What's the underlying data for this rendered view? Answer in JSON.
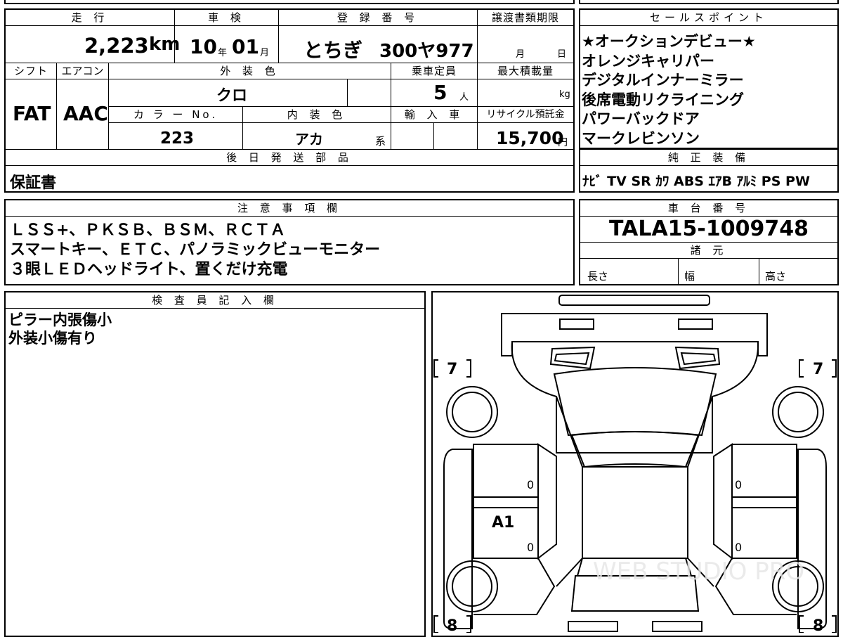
{
  "top_info": {
    "mileage_label": "走 行",
    "mileage_value": "2,223",
    "mileage_unit": "km",
    "inspection_label": "車 検",
    "inspection_year": "10",
    "inspection_year_unit": "年",
    "inspection_month": "01",
    "inspection_month_unit": "月",
    "registration_label": "登 録 番 号",
    "registration_region": "とちぎ",
    "registration_number": "300ヤ977",
    "transfer_deadline_label": "譲渡書類期限",
    "transfer_month_unit": "月",
    "transfer_day_unit": "日"
  },
  "spec": {
    "shift_label": "シフト",
    "shift_value": "FAT",
    "aircon_label": "エアコン",
    "aircon_value": "AAC",
    "exterior_color_label": "外 装 色",
    "exterior_color_value": "クロ",
    "capacity_label": "乗車定員",
    "capacity_value": "5",
    "capacity_unit": "人",
    "max_load_label": "最大積載量",
    "max_load_unit": "kg",
    "color_no_label": "カ ラ ー No.",
    "color_no_value": "223",
    "interior_color_label": "内 装 色",
    "interior_color_value": "アカ",
    "interior_color_suffix": "系",
    "import_label": "輸 入 車",
    "recycle_label": "リサイクル預託金",
    "recycle_value": "15,700",
    "recycle_unit": "円"
  },
  "later_parts": {
    "label": "後 日 発 送 部 品",
    "value": "保証書"
  },
  "sales_points": {
    "label": "セールスポイント",
    "items": [
      "★オークションデビュー★",
      "オレンジキャリパー",
      "デジタルインナーミラー",
      "後席電動リクライニング",
      "パワーバックドア",
      "マークレビンソン"
    ]
  },
  "genuine_equipment": {
    "label": "純 正 装 備",
    "items": [
      "ﾅﾋﾞ",
      "TV",
      "SR",
      "ｶﾜ",
      "ABS",
      "ｴｱB",
      "ｱﾙﾐ",
      "PS",
      "PW"
    ]
  },
  "notes": {
    "label": "注 意 事 項 欄",
    "lines": [
      "ＬＳＳ+、ＰＫＳＢ、ＢＳＭ、ＲＣＴＡ",
      "スマートキー、ＥＴＣ、パノラミックビューモニター",
      "３眼ＬＥＤヘッドライト、置くだけ充電"
    ]
  },
  "chassis": {
    "label": "車 台 番 号",
    "value": "TALA15-1009748",
    "specs_label": "諸 元",
    "length_label": "長さ",
    "width_label": "幅",
    "height_label": "高さ"
  },
  "inspector": {
    "label": "検 査 員 記 入 欄",
    "lines": [
      "ピラー内張傷小",
      "外装小傷有り"
    ]
  },
  "diagram": {
    "tire_front_left": "7",
    "tire_front_right": "7",
    "tire_rear_left": "8",
    "tire_rear_right": "8",
    "door_fl": "0",
    "door_fr": "0",
    "door_rl": "0",
    "door_rr": "0",
    "damage_code": "A1",
    "watermark": "WEB STUDIO PRO"
  }
}
